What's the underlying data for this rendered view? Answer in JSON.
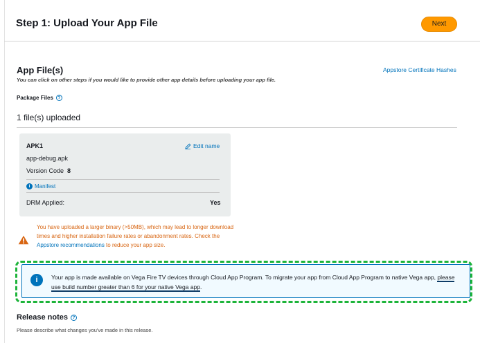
{
  "header": {
    "title": "Step 1: Upload Your App File",
    "next_label": "Next"
  },
  "app_files": {
    "title": "App File(s)",
    "subtitle": "You can click on other steps if you would like to provide other app details before uploading your app file.",
    "cert_link": "Appstore Certificate Hashes",
    "package_label": "Package Files",
    "uploaded_count": "1 file(s) uploaded"
  },
  "apk_card": {
    "name": "APK1",
    "edit_label": "Edit name",
    "file_name": "app-debug.apk",
    "version_label": "Version Code",
    "version_value": "8",
    "manifest_label": "Manifest",
    "drm_label": "DRM Applied:",
    "drm_value": "Yes"
  },
  "warning": {
    "text_before": "You have uploaded a larger binary (>50MB), which may lead to longer download times and higher installation failure rates or abandonment rates. Check the ",
    "link": "Appstore recommendations",
    "text_after": " to reduce your app size."
  },
  "info_banner": {
    "text_before": "Your app is made available on Vega Fire TV devices through Cloud App Program. To migrate your app from Cloud App Program to native Vega app, ",
    "text_underlined": "please use build number greater than 6 for your native Vega app",
    "text_after": "."
  },
  "release_notes": {
    "title": "Release notes",
    "description": "Please describe what changes you've made in this release."
  },
  "colors": {
    "accent": "#ff9900",
    "link": "#0073bb",
    "warning": "#d86613",
    "highlight": "#1db43a"
  },
  "icons": [
    "help-icon",
    "pencil-icon",
    "info-icon",
    "warning-icon"
  ]
}
